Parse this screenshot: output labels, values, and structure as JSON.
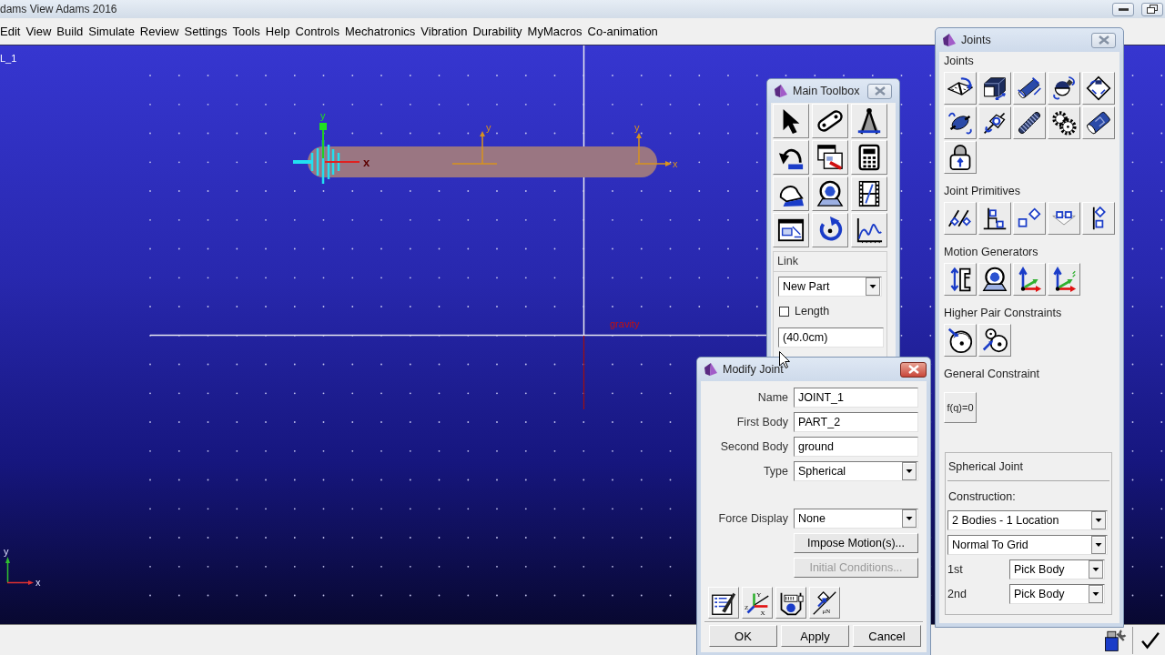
{
  "window": {
    "title": "dams View Adams 2016"
  },
  "menu": [
    "Edit",
    "View",
    "Build",
    "Simulate",
    "Review",
    "Settings",
    "Tools",
    "Help",
    "Controls",
    "Mechatronics",
    "Vibration",
    "Durability",
    "MyMacros",
    "Co-animation"
  ],
  "viewport": {
    "model_label": "L_1",
    "joint_marker_labels": [
      "y",
      "x"
    ],
    "part_markers": [
      {
        "labels": [
          "y"
        ]
      },
      {
        "labels": [
          "y",
          "x"
        ]
      }
    ],
    "gravity_label": "gravity",
    "triad_labels": [
      "y",
      "x"
    ]
  },
  "main_toolbox": {
    "title": "Main Toolbox",
    "active": false,
    "group_title": "Link",
    "part_menu": "New Part",
    "length_option": {
      "label": "Length",
      "checked": false
    },
    "length_field": "(40.0cm)"
  },
  "joints_panel": {
    "title": "Joints",
    "active": false,
    "sections": [
      {
        "heading": "Joints"
      },
      {
        "heading": "Joint Primitives"
      },
      {
        "heading": "Motion Generators"
      },
      {
        "heading": "Higher Pair Constraints"
      },
      {
        "heading": "General Constraint",
        "button": "f(q)=0"
      }
    ],
    "options": {
      "title": "Spherical Joint",
      "construction_label": "Construction:",
      "construction": "2 Bodies - 1 Location",
      "orientation": "Normal To Grid",
      "bodies": [
        {
          "label": "1st",
          "value": "Pick Body"
        },
        {
          "label": "2nd",
          "value": "Pick Body"
        }
      ]
    }
  },
  "modify_joint": {
    "title": "Modify Joint",
    "active": true,
    "fields": [
      {
        "label": "Name",
        "value": "JOINT_1",
        "kind": "text"
      },
      {
        "label": "First Body",
        "value": "PART_2",
        "kind": "text"
      },
      {
        "label": "Second Body",
        "value": "ground",
        "kind": "text"
      },
      {
        "label": "Type",
        "value": "Spherical",
        "kind": "menu"
      }
    ],
    "force_display": {
      "label": "Force Display",
      "value": "None"
    },
    "buttons": [
      {
        "label": "Impose Motion(s)...",
        "disabled": false
      },
      {
        "label": "Initial Conditions...",
        "disabled": true
      }
    ],
    "tool_icon_labels": {
      "axes": [
        "Y",
        "Z",
        "X"
      ],
      "slash": "μN"
    },
    "footer_buttons": [
      "OK",
      "Apply",
      "Cancel"
    ]
  }
}
